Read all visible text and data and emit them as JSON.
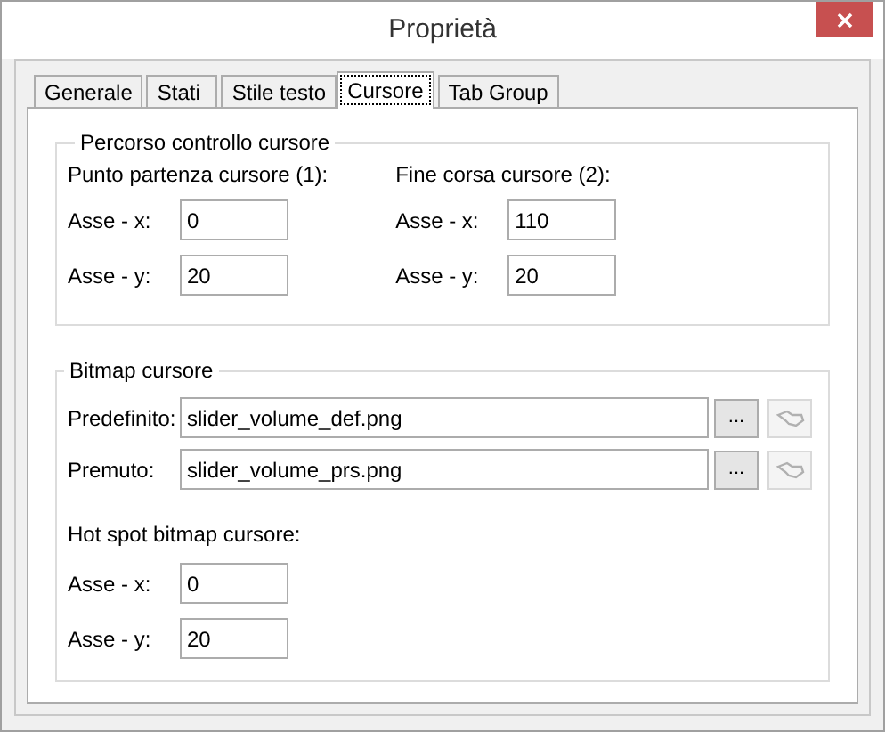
{
  "window": {
    "title": "Proprietà"
  },
  "tabs": [
    {
      "label": "Generale",
      "selected": false
    },
    {
      "label": "Stati",
      "selected": false
    },
    {
      "label": "Stile testo",
      "selected": false
    },
    {
      "label": "Cursore",
      "selected": true
    },
    {
      "label": "Tab Group",
      "selected": false
    }
  ],
  "path_group": {
    "title": "Percorso controllo cursore",
    "columns": [
      {
        "title": "Punto partenza cursore (1):",
        "fields": [
          {
            "label": "Asse - x:",
            "value": "0"
          },
          {
            "label": "Asse - y:",
            "value": "20"
          }
        ]
      },
      {
        "title": "Fine corsa cursore (2):",
        "fields": [
          {
            "label": "Asse - x:",
            "value": "110"
          },
          {
            "label": "Asse - y:",
            "value": "20"
          }
        ]
      }
    ]
  },
  "bitmap_group": {
    "title": "Bitmap cursore",
    "files": [
      {
        "label": "Predefinito:",
        "value": "slider_volume_def.png",
        "browse": "...",
        "picker_disabled": true
      },
      {
        "label": "Premuto:",
        "value": "slider_volume_prs.png",
        "browse": "...",
        "picker_disabled": true
      }
    ],
    "hotspot": {
      "title": "Hot spot bitmap cursore:",
      "fields": [
        {
          "label": "Asse - x:",
          "value": "0"
        },
        {
          "label": "Asse - y:",
          "value": "20"
        }
      ]
    }
  }
}
